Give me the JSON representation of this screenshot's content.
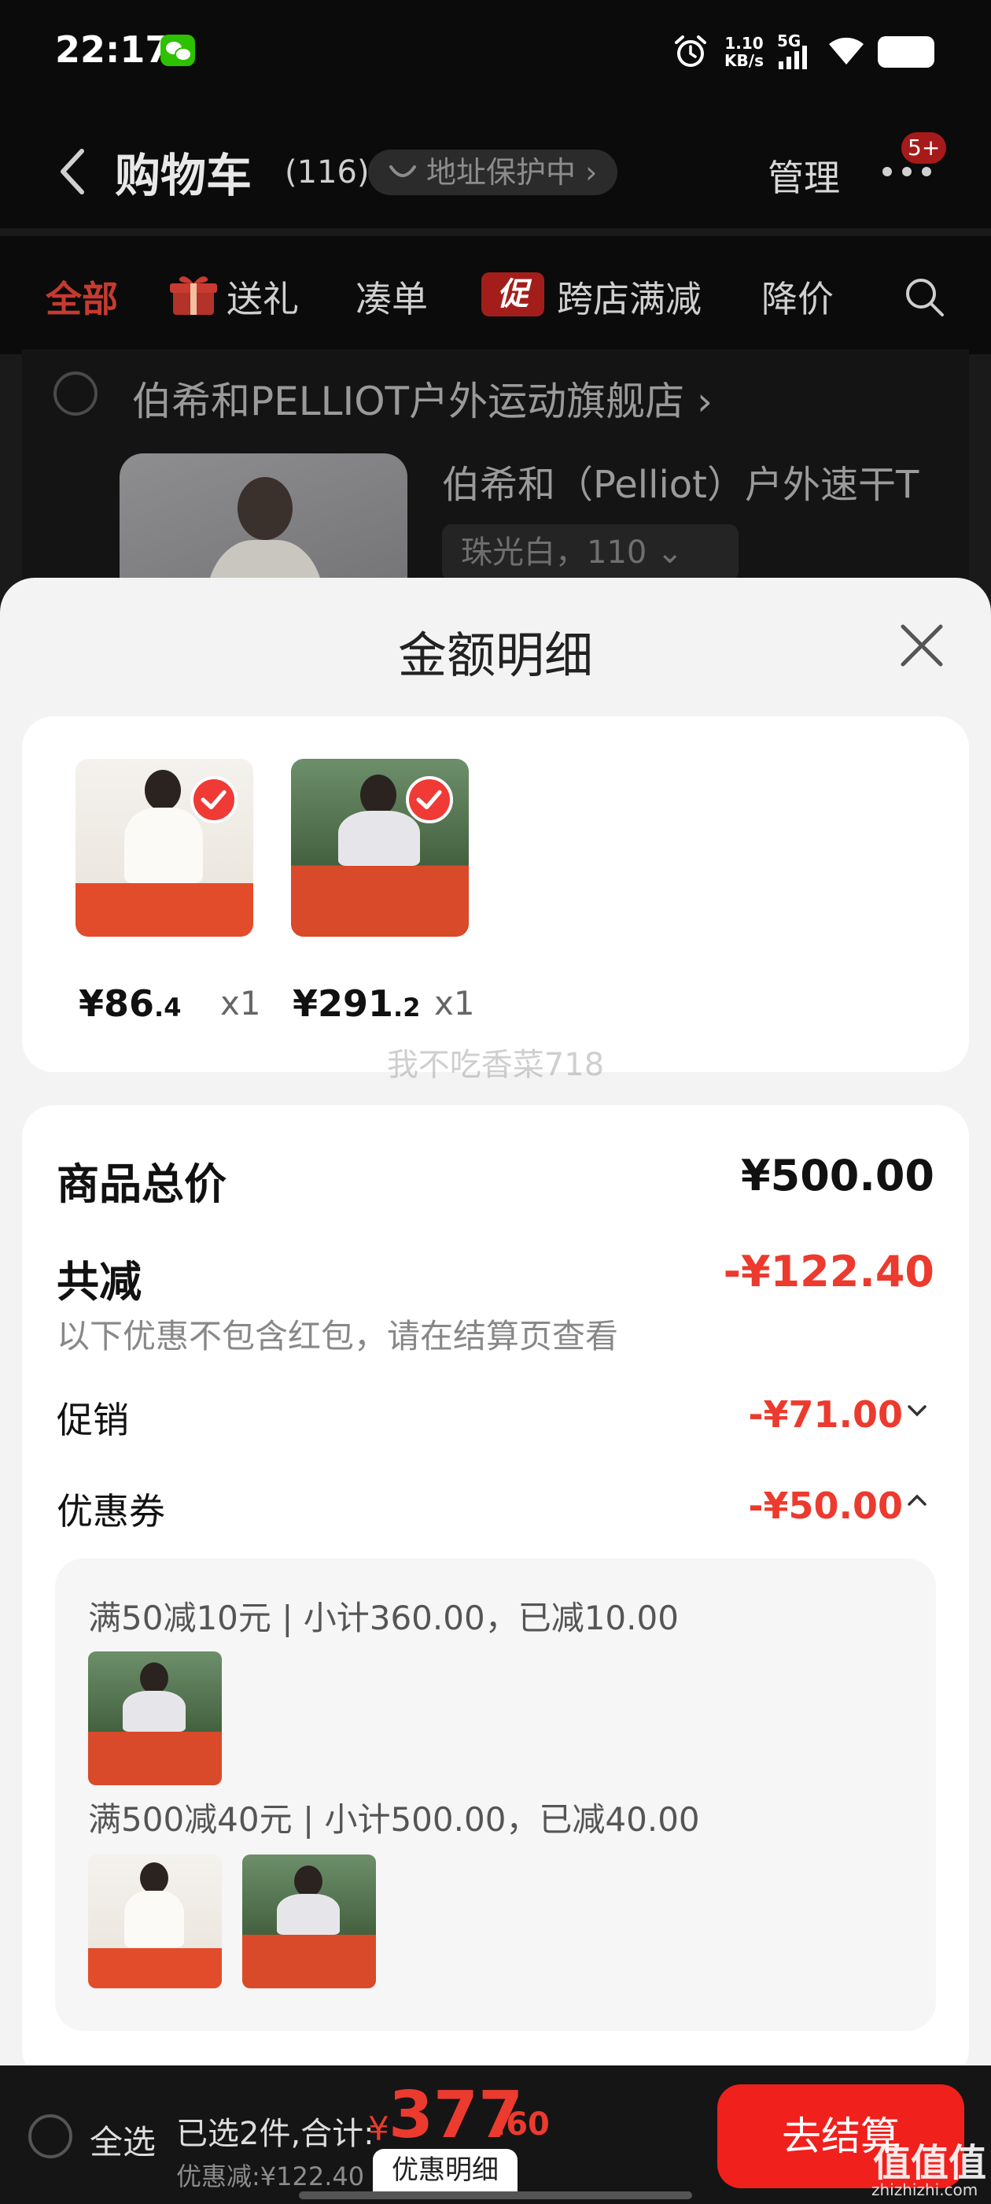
{
  "status_bar": {
    "time": "22:17",
    "net_speed_value": "1.10",
    "net_speed_unit": "KB/s",
    "network": "5G"
  },
  "cart_header": {
    "title": "购物车",
    "count": "(116)",
    "address_status": "地址保护中 ›",
    "manage": "管理",
    "more_badge": "5+"
  },
  "filter_tabs": {
    "all": "全部",
    "gift": "送礼",
    "bundle": "凑单",
    "promo_badge": "促",
    "cross_store": "跨店满减",
    "price_drop": "降价"
  },
  "store": {
    "name": "伯希和PELLIOT户外运动旗舰店 ›",
    "product_title": "伯希和（Pelliot）户外速干T",
    "product_variant": "珠光白，110 ⌄"
  },
  "sheet": {
    "title": "金额明细",
    "goods": [
      {
        "price_int": "¥86",
        "price_dec": ".4",
        "qty": "x1"
      },
      {
        "price_int": "¥291",
        "price_dec": ".2",
        "qty": "x1"
      }
    ],
    "watermark": "我不吃香菜718",
    "subtotal_label": "商品总价",
    "subtotal_value": "¥500.00",
    "reduced_label": "共减",
    "reduced_value": "-¥122.40",
    "reduced_note": "以下优惠不包含红包，请在结算页查看",
    "promo_label": "促销",
    "promo_value": "-¥71.00",
    "coupon_label": "优惠券",
    "coupon_value": "-¥50.00",
    "coupon_rules": [
      "满50减10元 | 小计360.00，已减10.00",
      "满500减40元 | 小计500.00，已减40.00"
    ]
  },
  "checkout": {
    "select_all": "全选",
    "selected_summary": "已选2件,合计:",
    "currency": "¥",
    "total_int": "377",
    "total_dec": ".60",
    "discount_line": "优惠减:¥122.40",
    "detail_link": "优惠明细",
    "checkout_button": "去结算"
  },
  "watermark_site": {
    "logo": "值值值",
    "url": "zhizhizhi.com"
  },
  "colors": {
    "accent_red": "#ec3a2e",
    "checkout_red": "#f0201d",
    "sheet_bg": "#f3f3f3"
  },
  "icons": [
    "wechat-icon",
    "alarm-icon",
    "signal-icon",
    "wifi-icon",
    "battery-icon",
    "back-icon",
    "more-icon",
    "gift-icon",
    "search-icon",
    "close-icon",
    "check-icon",
    "chevron-down-icon",
    "chevron-up-icon"
  ]
}
